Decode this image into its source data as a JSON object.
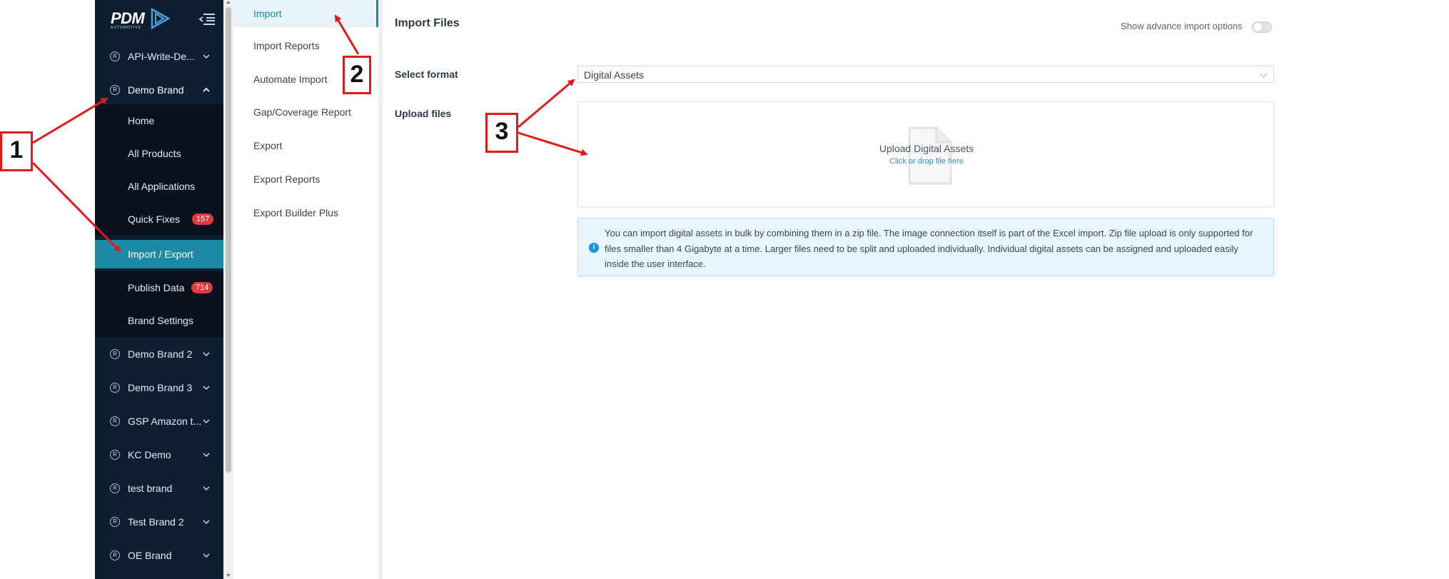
{
  "sidebar": {
    "logo_text": "PDM",
    "logo_sub": "AUTOMOTIVE",
    "brands_top": [
      {
        "label": "API-Write-De...",
        "registered": "R"
      }
    ],
    "active_brand": {
      "label": "Demo Brand",
      "registered": "R"
    },
    "sub_items": [
      {
        "label": "Home"
      },
      {
        "label": "All Products"
      },
      {
        "label": "All Applications"
      },
      {
        "label": "Quick Fixes",
        "badge": "157"
      },
      {
        "label": "Import / Export",
        "active": true
      },
      {
        "label": "Publish Data",
        "badge": "714"
      },
      {
        "label": "Brand Settings"
      }
    ],
    "brands_bottom": [
      {
        "label": "Demo Brand 2"
      },
      {
        "label": "Demo Brand 3"
      },
      {
        "label": "GSP Amazon t..."
      },
      {
        "label": "KC Demo"
      },
      {
        "label": "test brand"
      },
      {
        "label": "Test Brand 2"
      },
      {
        "label": "OE Brand"
      }
    ],
    "registered_mark": "R"
  },
  "submenu": {
    "items": [
      {
        "label": "Import",
        "active": true
      },
      {
        "label": "Import Reports"
      },
      {
        "label": "Automate Import"
      },
      {
        "label": "Gap/Coverage Report"
      },
      {
        "label": "Export"
      },
      {
        "label": "Export Reports"
      },
      {
        "label": "Export Builder Plus"
      }
    ]
  },
  "main": {
    "title": "Import Files",
    "advance_label": "Show advance import options",
    "advance_enabled": false,
    "select_format_label": "Select format",
    "select_format_value": "Digital Assets",
    "upload_label": "Upload files",
    "upload_title": "Upload Digital Assets",
    "upload_hint": "Click or drop file here",
    "info_text": "You can import digital assets in bulk by combining them in a zip file. The image connection itself is part of the Excel import. Zip file upload is only supported for files smaller than 4 Gigabyte at a time. Larger files need to be split and uploaded individually. Individual digital assets can be assigned and uploaded easily inside the user interface.",
    "info_icon": "i"
  },
  "annotations": {
    "one": "1",
    "two": "2",
    "three": "3"
  },
  "colors": {
    "sidebar_bg": "#0f1f33",
    "accent": "#1c8aa5",
    "badge": "#e0393e",
    "annotation": "#e01b1b"
  }
}
